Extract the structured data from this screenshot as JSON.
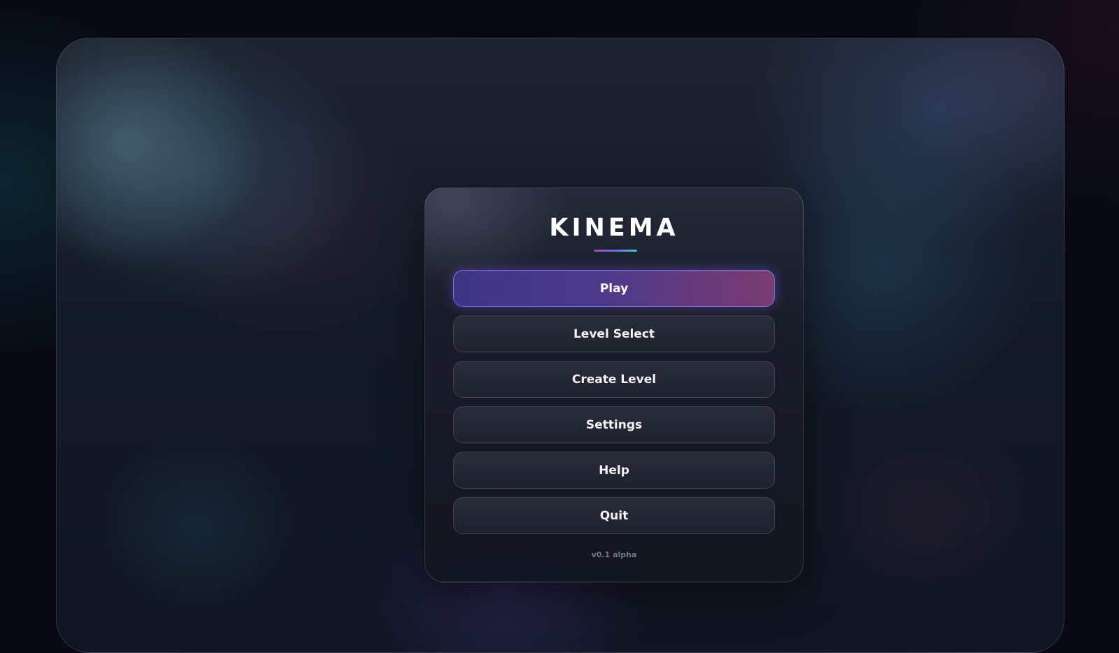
{
  "app": {
    "title": "KINEMA",
    "version": "v0.1 alpha"
  },
  "menu": {
    "items": [
      {
        "label": "Play",
        "state": "highlighted"
      },
      {
        "label": "Level Select"
      },
      {
        "label": "Create Level"
      },
      {
        "label": "Settings"
      },
      {
        "label": "Help"
      },
      {
        "label": "Quit"
      }
    ]
  },
  "colors": {
    "accent_primary": "#4b3a8c",
    "accent_secondary": "#7a3d6f",
    "underline_start": "#a14ab8",
    "underline_end": "#3fc4d8",
    "background": "#070a14"
  }
}
